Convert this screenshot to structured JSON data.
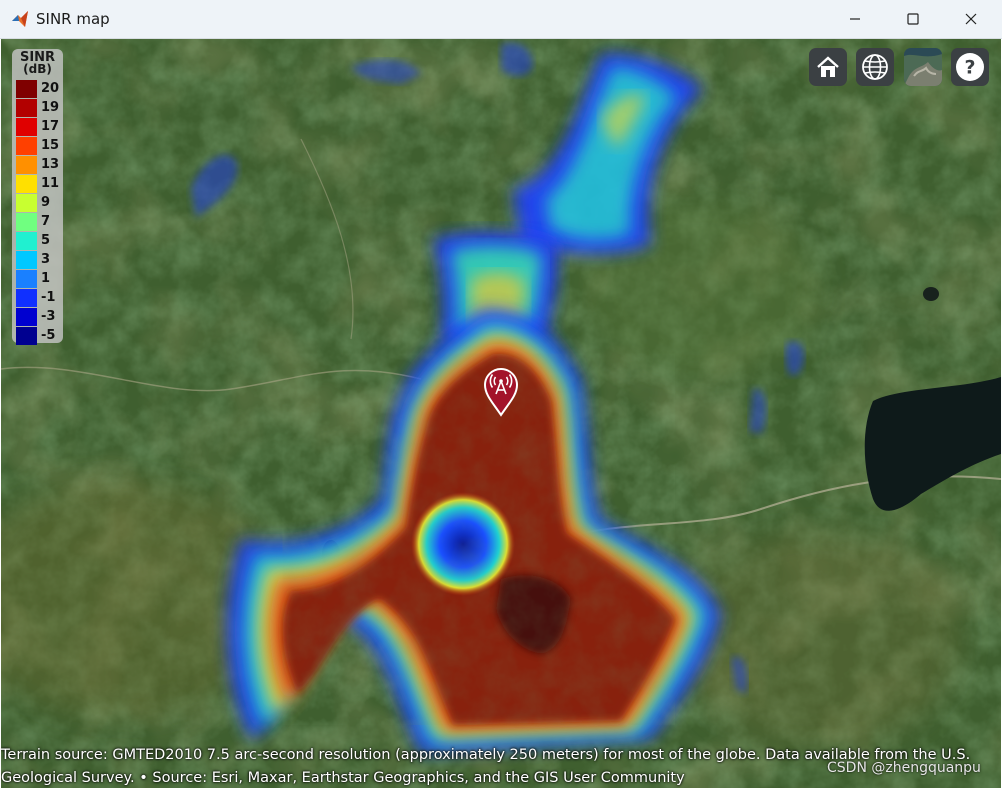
{
  "window": {
    "title": "SINR map"
  },
  "icons": {
    "app": "matlab-icon",
    "minimize": "minimize-icon",
    "maximize": "maximize-icon",
    "close": "close-icon",
    "home": "home-icon",
    "globe": "globe-icon",
    "basemap": "basemap-icon",
    "help": "help-icon",
    "marker": "cell-tower-marker-icon"
  },
  "toolbar": {
    "help_label": "?"
  },
  "legend": {
    "title": "SINR",
    "unit": "(dB)",
    "entries": [
      {
        "label": "20",
        "color": "#7f0000"
      },
      {
        "label": "19",
        "color": "#b20000"
      },
      {
        "label": "17",
        "color": "#e00000"
      },
      {
        "label": "15",
        "color": "#ff4000"
      },
      {
        "label": "13",
        "color": "#ff9000"
      },
      {
        "label": "11",
        "color": "#ffe000"
      },
      {
        "label": "9",
        "color": "#c8ff30"
      },
      {
        "label": "7",
        "color": "#70ff80"
      },
      {
        "label": "5",
        "color": "#20f0d0"
      },
      {
        "label": "3",
        "color": "#00c8ff"
      },
      {
        "label": "1",
        "color": "#1a80ff"
      },
      {
        "label": "-1",
        "color": "#1030ff"
      },
      {
        "label": "-3",
        "color": "#0000d0"
      },
      {
        "label": "-5",
        "color": "#000090"
      }
    ]
  },
  "attribution": {
    "line1": "Terrain source: GMTED2010 7.5 arc-second resolution (approximately 250 meters) for most of the globe. Data available from the U.S.",
    "line2": "Geological Survey. • Source: Esri, Maxar, Earthstar Geographics, and the GIS User Community"
  },
  "watermark": "CSDN @zhengquanpu",
  "colors": {
    "titlebar_bg": "#eef3f8",
    "button_bg": "#3b4043",
    "marker": "#a3132a",
    "coverage_high": "#7f1a08"
  }
}
